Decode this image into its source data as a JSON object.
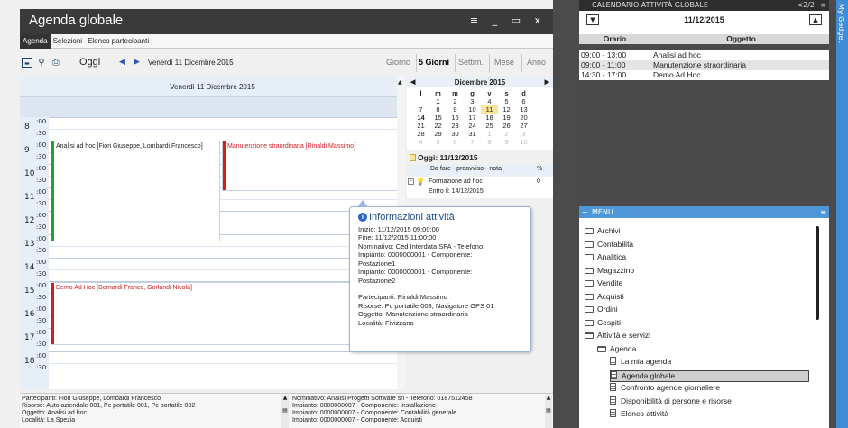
{
  "window": {
    "title": "Agenda globale",
    "controls": "≡ _ ▭ x"
  },
  "menu_tabs": [
    {
      "label": "Agenda",
      "active": true
    },
    {
      "label": "Selezioni"
    },
    {
      "label": "Elenco partecipanti"
    }
  ],
  "toolbar": {
    "oggi_label": "Oggi",
    "date_label": "Venerdì 11 Dicembre 2015",
    "views": [
      {
        "label": "Giorno"
      },
      {
        "label": "5 Giorni",
        "selected": true
      },
      {
        "label": "Settim."
      },
      {
        "label": "Mese"
      },
      {
        "label": "Anno"
      }
    ]
  },
  "day_header": "Venerdì 11 Dicembre 2015",
  "hours": [
    "8",
    "9",
    "10",
    "11",
    "12",
    "13",
    "14",
    "15",
    "16",
    "17",
    "18"
  ],
  "minute_labels": [
    ":00",
    ":30"
  ],
  "events": [
    {
      "label": "Analisi ad hoc  [Fiori Giuseppe, Lombardi Francesco]",
      "color": "#27a02f",
      "text_color": "#222"
    },
    {
      "label": "Manutenzione straordinaria  [Rinaldi Massimo]",
      "color": "#d31e1e",
      "text_color": "#d31e1e"
    },
    {
      "label": "Demo Ad Hoc  [Bernardi Franco, Gorlandi Nicola]",
      "color": "#d31e1e",
      "text_color": "#d31e1e"
    }
  ],
  "mini_calendar": {
    "month": "Dicembre 2015",
    "weekdays": [
      "l",
      "m",
      "m",
      "g",
      "v",
      "s",
      "d"
    ],
    "weeks": [
      [
        "",
        "1",
        "2",
        "3",
        "4",
        "5",
        "6"
      ],
      [
        "7",
        "8",
        "9",
        "10",
        "11",
        "12",
        "13"
      ],
      [
        "14",
        "15",
        "16",
        "17",
        "18",
        "19",
        "20"
      ],
      [
        "21",
        "22",
        "23",
        "24",
        "25",
        "26",
        "27"
      ],
      [
        "28",
        "29",
        "30",
        "31",
        "1",
        "2",
        "3"
      ],
      [
        "4",
        "5",
        "6",
        "7",
        "8",
        "9",
        "10"
      ]
    ],
    "today_label": "Oggi: 11/12/2015"
  },
  "todo": {
    "header": "Da fare - preavviso - nota",
    "pct_header": "%",
    "item": "Formazione ad hoc",
    "item_sub": "Entro il: 14/12/2015",
    "item_pct": "0"
  },
  "tooltip": {
    "title": "Informazioni attività",
    "lines": [
      "Inizio: 11/12/2015 09:00:00",
      "Fine: 11/12/2015 11:00:00",
      "Nominativo: Ced Interdata SPA - Telefono:",
      "Impianto: 0000000001 - Componente:",
      "Postazione1",
      "Impianto: 0000000001 - Componente:",
      "Postazione2",
      "",
      "Partecipanti: Rinaldi Massimo",
      "Risorse: Pc portatile 003, Navigatore GPS 01",
      "Oggetto: Manutenzione straordinaria",
      "Località: Fivizzano"
    ]
  },
  "details_left": [
    "Partecipanti: Fiori Giuseppe, Lombardi Francesco",
    "Risorse: Auto aziendale 001, Pc portatile 001, Pc portatile 002",
    "Oggetto: Analisi ad hoc",
    "Località: La Spezia"
  ],
  "details_right": [
    "Nominativo: Analisi Progetti Software srl - Telefono: 0187512458",
    "Impianto: 0000000007 - Componente: Installazione",
    "Impianto: 0000000007 - Componente: Contabilità generale",
    "Impianto: 0000000007 - Componente: Acquisti"
  ],
  "calendar_panel": {
    "title": "CALENDARIO ATTIVITÀ GLOBALE",
    "page": "<2/2",
    "date": "11/12/2015",
    "col_orario": "Orario",
    "col_oggetto": "Oggetto",
    "rows": [
      {
        "time": "09:00 - 13:00",
        "subject": "Analisi ad hoc"
      },
      {
        "time": "09:00 - 11:00",
        "subject": "Manutenzione straordinaria"
      },
      {
        "time": "14:30 - 17:00",
        "subject": "Demo Ad Hoc"
      }
    ]
  },
  "menu_panel": {
    "title": "MENU",
    "items": [
      {
        "label": "Archivi",
        "type": "folder",
        "level": 0
      },
      {
        "label": "Contabilità",
        "type": "folder",
        "level": 0
      },
      {
        "label": "Analitica",
        "type": "folder",
        "level": 0
      },
      {
        "label": "Magazzino",
        "type": "folder",
        "level": 0
      },
      {
        "label": "Vendite",
        "type": "folder",
        "level": 0
      },
      {
        "label": "Acquisti",
        "type": "folder",
        "level": 0
      },
      {
        "label": "Ordini",
        "type": "folder",
        "level": 0
      },
      {
        "label": "Cespiti",
        "type": "folder",
        "level": 0
      },
      {
        "label": "Attività e servizi",
        "type": "folder-open",
        "level": 0
      },
      {
        "label": "Agenda",
        "type": "folder-open",
        "level": 1
      },
      {
        "label": "La mia agenda",
        "type": "doc",
        "level": 2
      },
      {
        "label": "Agenda globale",
        "type": "doc",
        "level": 2,
        "selected": true
      },
      {
        "label": "Confronto agende giornaliere",
        "type": "doc",
        "level": 2
      },
      {
        "label": "Disponibilità di persone e risorse",
        "type": "doc",
        "level": 2
      },
      {
        "label": "Elenco attività",
        "type": "doc",
        "level": 2
      }
    ]
  },
  "side_gadget": "My Gadget",
  "colors": {
    "accent": "#4e96d8",
    "selection": "#2a64c4",
    "today": "#fbe49a",
    "dark_title": "#3a3a3a"
  },
  "icons": [
    "calendar-icon",
    "search-icon",
    "print-icon",
    "prev-arrow-icon",
    "next-arrow-icon",
    "folder-icon",
    "document-icon",
    "info-icon",
    "lightbulb-icon",
    "menu-icon"
  ]
}
